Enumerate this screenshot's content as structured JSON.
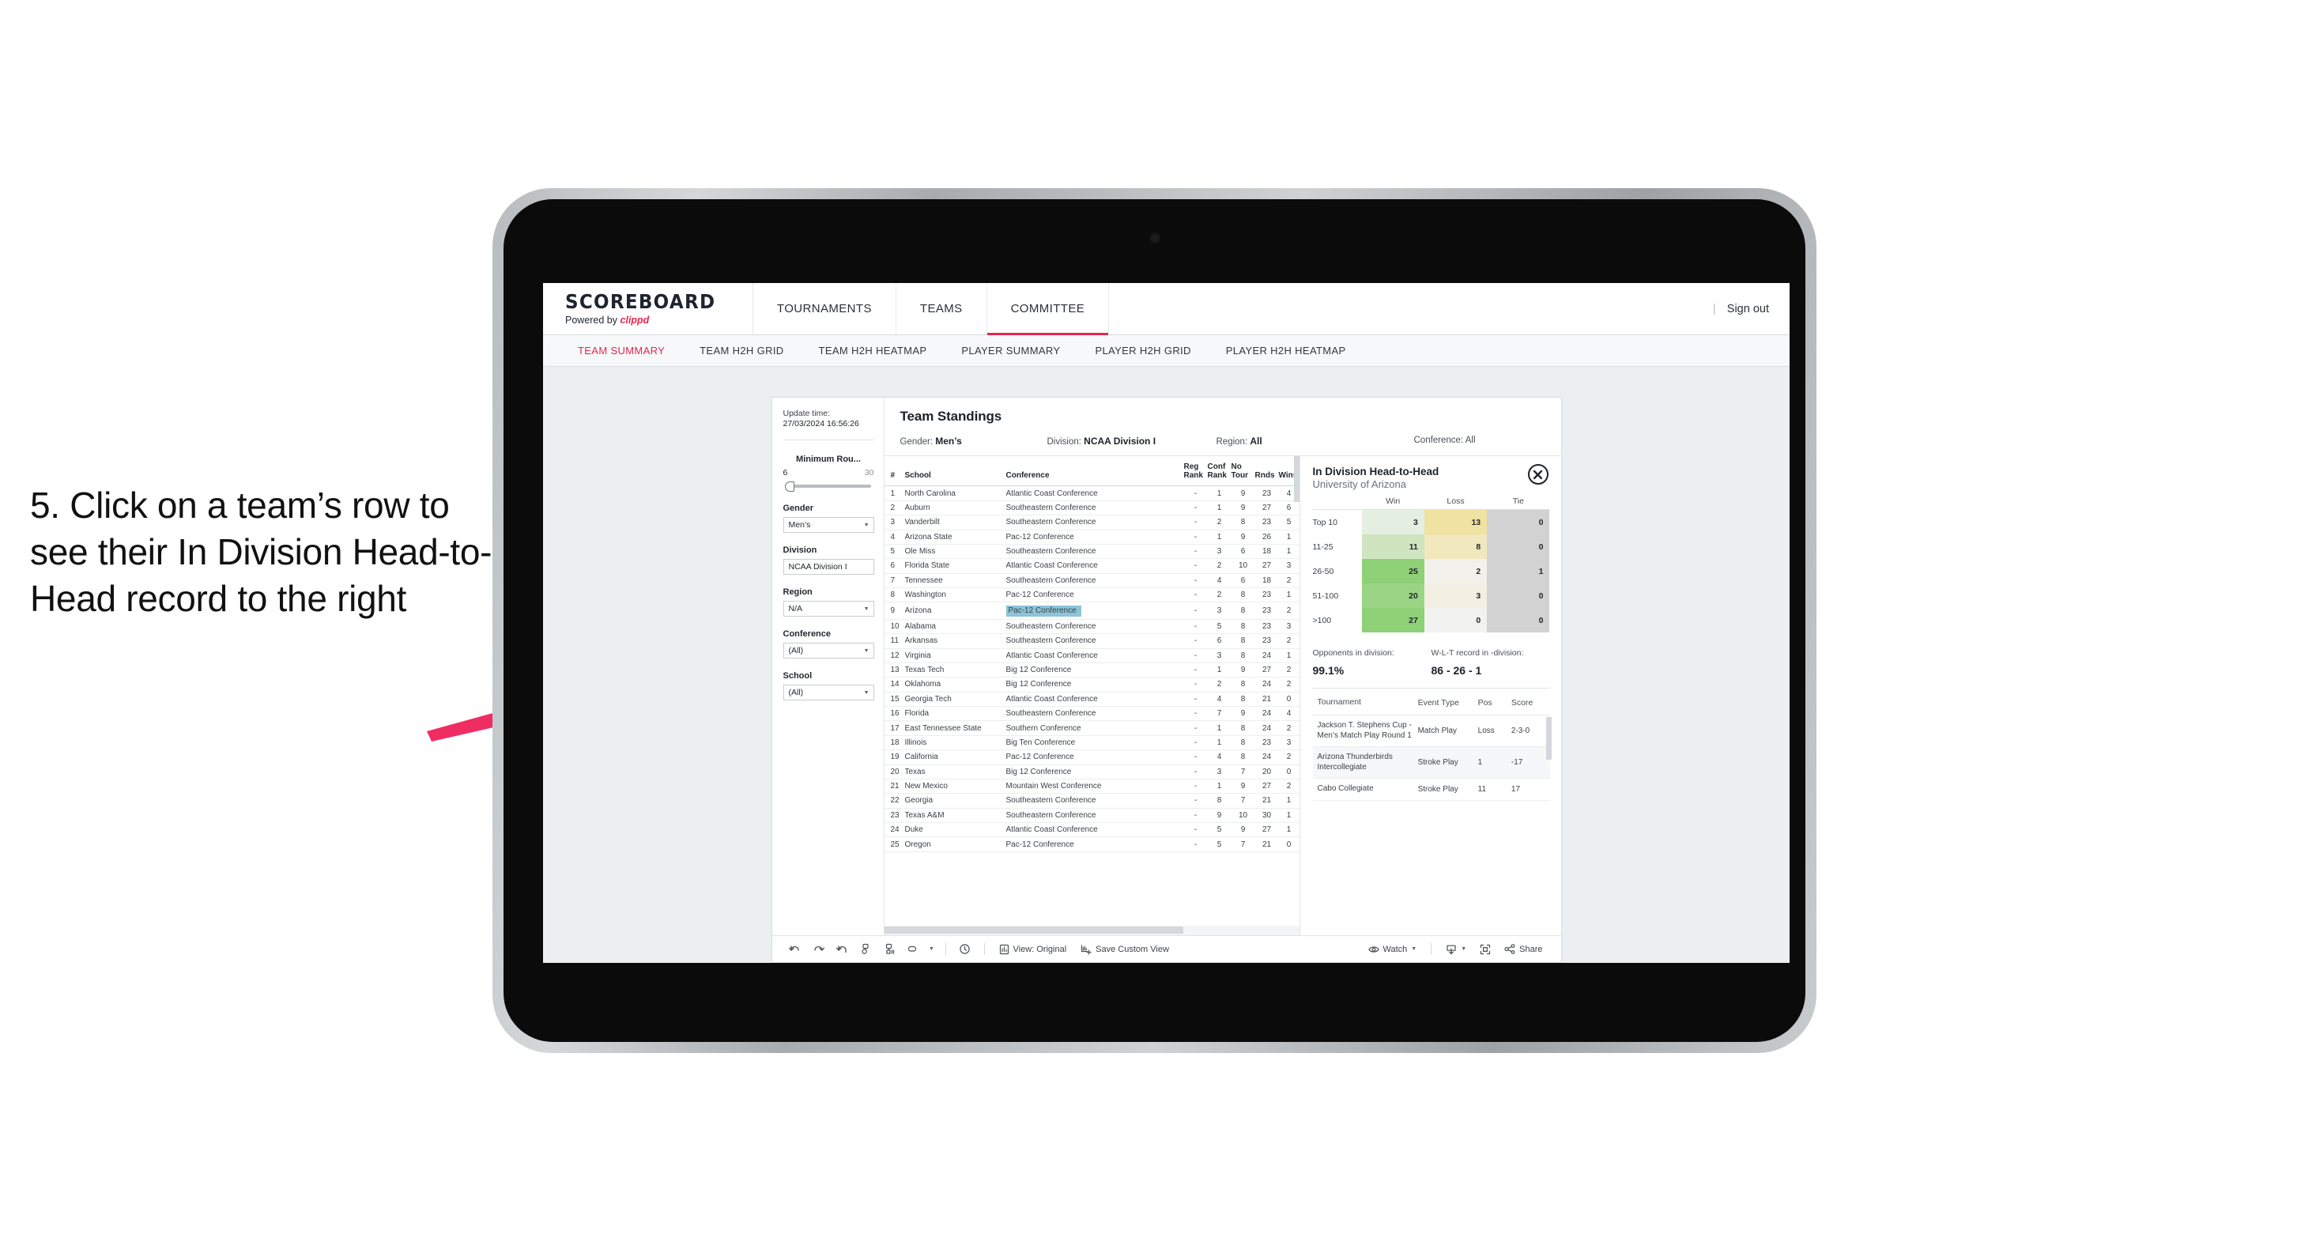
{
  "annotation": {
    "text": "5. Click on a team’s row to see their In Division Head-to-Head record to the right",
    "arrow_color": "#ef2d62"
  },
  "app": {
    "brand": {
      "title": "SCOREBOARD",
      "powered_prefix": "Powered by ",
      "powered_name": "clippd"
    },
    "nav": [
      {
        "label": "TOURNAMENTS",
        "active": false
      },
      {
        "label": "TEAMS",
        "active": false
      },
      {
        "label": "COMMITTEE",
        "active": true
      }
    ],
    "header_right": {
      "separator": "|",
      "signout": "Sign out"
    },
    "subnav": [
      {
        "label": "TEAM SUMMARY",
        "active": true
      },
      {
        "label": "TEAM H2H GRID",
        "active": false
      },
      {
        "label": "TEAM H2H HEATMAP",
        "active": false
      },
      {
        "label": "PLAYER SUMMARY",
        "active": false
      },
      {
        "label": "PLAYER H2H GRID",
        "active": false
      },
      {
        "label": "PLAYER H2H HEATMAP",
        "active": false
      }
    ]
  },
  "filters": {
    "update_time_label": "Update time:",
    "update_time_value": "27/03/2024 16:56:26",
    "min_rounds": {
      "label": "Minimum Rou...",
      "min": "6",
      "max": "30"
    },
    "gender": {
      "label": "Gender",
      "value": "Men’s"
    },
    "division": {
      "label": "Division",
      "value": "NCAA Division I"
    },
    "region": {
      "label": "Region",
      "value": "N/A"
    },
    "conference": {
      "label": "Conference",
      "value": "(All)"
    },
    "school": {
      "label": "School",
      "value": "(All)"
    }
  },
  "standings": {
    "title": "Team Standings",
    "meta": {
      "gender_label": "Gender: ",
      "gender_value": "Men’s",
      "division_label": "Division: ",
      "division_value": "NCAA Division I",
      "region_label": "Region: ",
      "region_value": "All",
      "conference_label": "Conference: ",
      "conference_value": "All"
    },
    "columns": [
      "#",
      "School",
      "Conference",
      "Reg Rank",
      "Conf Rank",
      "No Tour",
      "Rnds",
      "Wins"
    ],
    "columns_display": [
      {
        "l1": "#",
        "l2": ""
      },
      {
        "l1": "School",
        "l2": ""
      },
      {
        "l1": "Conference",
        "l2": ""
      },
      {
        "l1": "Reg",
        "l2": "Rank"
      },
      {
        "l1": "Conf",
        "l2": "Rank"
      },
      {
        "l1": "No",
        "l2": "Tour"
      },
      {
        "l1": "",
        "l2": "Rnds"
      },
      {
        "l1": "",
        "l2": "Wins"
      }
    ],
    "selected_rank": 9,
    "highlight_color": "#8cc4d8",
    "rows": [
      {
        "rank": "1",
        "school": "North Carolina",
        "conference": "Atlantic Coast Conference",
        "reg_rank": "-",
        "conf_rank": "1",
        "no_tour": "9",
        "rnds": "23",
        "wins": "4"
      },
      {
        "rank": "2",
        "school": "Auburn",
        "conference": "Southeastern Conference",
        "reg_rank": "-",
        "conf_rank": "1",
        "no_tour": "9",
        "rnds": "27",
        "wins": "6"
      },
      {
        "rank": "3",
        "school": "Vanderbilt",
        "conference": "Southeastern Conference",
        "reg_rank": "-",
        "conf_rank": "2",
        "no_tour": "8",
        "rnds": "23",
        "wins": "5"
      },
      {
        "rank": "4",
        "school": "Arizona State",
        "conference": "Pac-12 Conference",
        "reg_rank": "-",
        "conf_rank": "1",
        "no_tour": "9",
        "rnds": "26",
        "wins": "1"
      },
      {
        "rank": "5",
        "school": "Ole Miss",
        "conference": "Southeastern Conference",
        "reg_rank": "-",
        "conf_rank": "3",
        "no_tour": "6",
        "rnds": "18",
        "wins": "1"
      },
      {
        "rank": "6",
        "school": "Florida State",
        "conference": "Atlantic Coast Conference",
        "reg_rank": "-",
        "conf_rank": "2",
        "no_tour": "10",
        "rnds": "27",
        "wins": "3"
      },
      {
        "rank": "7",
        "school": "Tennessee",
        "conference": "Southeastern Conference",
        "reg_rank": "-",
        "conf_rank": "4",
        "no_tour": "6",
        "rnds": "18",
        "wins": "2"
      },
      {
        "rank": "8",
        "school": "Washington",
        "conference": "Pac-12 Conference",
        "reg_rank": "-",
        "conf_rank": "2",
        "no_tour": "8",
        "rnds": "23",
        "wins": "1"
      },
      {
        "rank": "9",
        "school": "Arizona",
        "conference": "Pac-12 Conference",
        "reg_rank": "-",
        "conf_rank": "3",
        "no_tour": "8",
        "rnds": "23",
        "wins": "2"
      },
      {
        "rank": "10",
        "school": "Alabama",
        "conference": "Southeastern Conference",
        "reg_rank": "-",
        "conf_rank": "5",
        "no_tour": "8",
        "rnds": "23",
        "wins": "3"
      },
      {
        "rank": "11",
        "school": "Arkansas",
        "conference": "Southeastern Conference",
        "reg_rank": "-",
        "conf_rank": "6",
        "no_tour": "8",
        "rnds": "23",
        "wins": "2"
      },
      {
        "rank": "12",
        "school": "Virginia",
        "conference": "Atlantic Coast Conference",
        "reg_rank": "-",
        "conf_rank": "3",
        "no_tour": "8",
        "rnds": "24",
        "wins": "1"
      },
      {
        "rank": "13",
        "school": "Texas Tech",
        "conference": "Big 12 Conference",
        "reg_rank": "-",
        "conf_rank": "1",
        "no_tour": "9",
        "rnds": "27",
        "wins": "2"
      },
      {
        "rank": "14",
        "school": "Oklahoma",
        "conference": "Big 12 Conference",
        "reg_rank": "-",
        "conf_rank": "2",
        "no_tour": "8",
        "rnds": "24",
        "wins": "2"
      },
      {
        "rank": "15",
        "school": "Georgia Tech",
        "conference": "Atlantic Coast Conference",
        "reg_rank": "-",
        "conf_rank": "4",
        "no_tour": "8",
        "rnds": "21",
        "wins": "0"
      },
      {
        "rank": "16",
        "school": "Florida",
        "conference": "Southeastern Conference",
        "reg_rank": "-",
        "conf_rank": "7",
        "no_tour": "9",
        "rnds": "24",
        "wins": "4"
      },
      {
        "rank": "17",
        "school": "East Tennessee State",
        "conference": "Southern Conference",
        "reg_rank": "-",
        "conf_rank": "1",
        "no_tour": "8",
        "rnds": "24",
        "wins": "2"
      },
      {
        "rank": "18",
        "school": "Illinois",
        "conference": "Big Ten Conference",
        "reg_rank": "-",
        "conf_rank": "1",
        "no_tour": "8",
        "rnds": "23",
        "wins": "3"
      },
      {
        "rank": "19",
        "school": "California",
        "conference": "Pac-12 Conference",
        "reg_rank": "-",
        "conf_rank": "4",
        "no_tour": "8",
        "rnds": "24",
        "wins": "2"
      },
      {
        "rank": "20",
        "school": "Texas",
        "conference": "Big 12 Conference",
        "reg_rank": "-",
        "conf_rank": "3",
        "no_tour": "7",
        "rnds": "20",
        "wins": "0"
      },
      {
        "rank": "21",
        "school": "New Mexico",
        "conference": "Mountain West Conference",
        "reg_rank": "-",
        "conf_rank": "1",
        "no_tour": "9",
        "rnds": "27",
        "wins": "2"
      },
      {
        "rank": "22",
        "school": "Georgia",
        "conference": "Southeastern Conference",
        "reg_rank": "-",
        "conf_rank": "8",
        "no_tour": "7",
        "rnds": "21",
        "wins": "1"
      },
      {
        "rank": "23",
        "school": "Texas A&M",
        "conference": "Southeastern Conference",
        "reg_rank": "-",
        "conf_rank": "9",
        "no_tour": "10",
        "rnds": "30",
        "wins": "1"
      },
      {
        "rank": "24",
        "school": "Duke",
        "conference": "Atlantic Coast Conference",
        "reg_rank": "-",
        "conf_rank": "5",
        "no_tour": "9",
        "rnds": "27",
        "wins": "1"
      },
      {
        "rank": "25",
        "school": "Oregon",
        "conference": "Pac-12 Conference",
        "reg_rank": "-",
        "conf_rank": "5",
        "no_tour": "7",
        "rnds": "21",
        "wins": "0"
      }
    ]
  },
  "h2h": {
    "title": "In Division Head-to-Head",
    "subtitle": "University of Arizona",
    "close_icon": "close-circle-icon",
    "heatmap": {
      "columns": [
        "Win",
        "Loss",
        "Tie"
      ],
      "rows": [
        {
          "label": "Top 10",
          "win": "3",
          "loss": "13",
          "tie": "0",
          "win_bg": "#e4efe1",
          "loss_bg": "#f0e2a0",
          "tie_bg": "#d2d2d2"
        },
        {
          "label": "11-25",
          "win": "11",
          "loss": "8",
          "tie": "0",
          "win_bg": "#cfe5c0",
          "loss_bg": "#f2e8bd",
          "tie_bg": "#d2d2d2"
        },
        {
          "label": "26-50",
          "win": "25",
          "loss": "2",
          "tie": "1",
          "win_bg": "#8ed177",
          "loss_bg": "#f2f1eb",
          "tie_bg": "#d2d2d2"
        },
        {
          "label": "51-100",
          "win": "20",
          "loss": "3",
          "tie": "0",
          "win_bg": "#9ad585",
          "loss_bg": "#f3efe3",
          "tie_bg": "#d2d2d2"
        },
        {
          "label": ">100",
          "win": "27",
          "loss": "0",
          "tie": "0",
          "win_bg": "#8ed177",
          "loss_bg": "#f2f2f0",
          "tie_bg": "#d2d2d2"
        }
      ]
    },
    "stats": {
      "opponents_label": "Opponents in division:",
      "opponents_value": "99.1%",
      "record_label": "W-L-T record in -division:",
      "record_value": "86 - 26 - 1"
    },
    "tournaments": {
      "columns": [
        "Tournament",
        "Event Type",
        "Pos",
        "Score"
      ],
      "rows": [
        {
          "tournament": "Jackson T. Stephens Cup - Men’s Match Play Round 1",
          "event_type": "Match Play",
          "pos": "Loss",
          "score": "2-3-0"
        },
        {
          "tournament": "Arizona Thunderbirds Intercollegiate",
          "event_type": "Stroke Play",
          "pos": "1",
          "score": "-17"
        },
        {
          "tournament": "Cabo Collegiate",
          "event_type": "Stroke Play",
          "pos": "11",
          "score": "17"
        }
      ]
    }
  },
  "toolbar": {
    "icons": [
      "undo-icon",
      "redo-icon",
      "revert-icon",
      "refresh-data-icon",
      "pause-updates-icon",
      "view-shape-icon"
    ],
    "dropdown_caret": "▾",
    "clock_icon": "history-icon",
    "view_label": "View: Original",
    "view_icon": "view-original-icon",
    "save_label": "Save Custom View",
    "save_icon": "save-view-icon",
    "watch_label": "Watch",
    "watch_icon": "eye-icon",
    "download_icon": "download-icon",
    "fullscreen_icon": "fullscreen-icon",
    "share_label": "Share",
    "share_icon": "share-icon"
  }
}
